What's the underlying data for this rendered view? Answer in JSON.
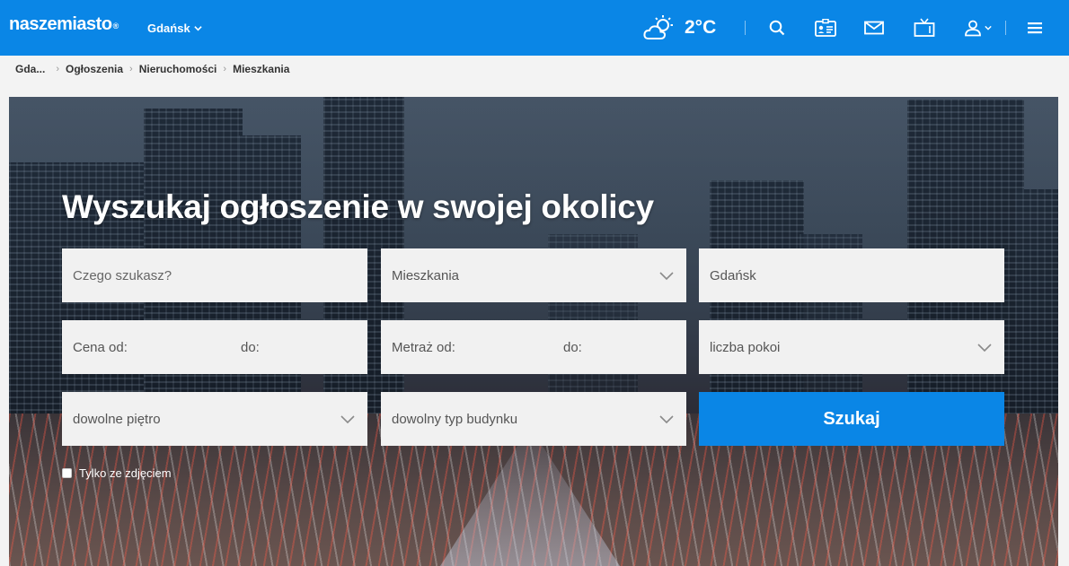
{
  "header": {
    "logo": "naszemiasto",
    "logo_reg": "®",
    "city": "Gdańsk",
    "temperature": "2°C",
    "icons": [
      "weather-icon",
      "search-icon",
      "id-card-icon",
      "mail-icon",
      "tv-icon",
      "user-icon",
      "menu-icon"
    ]
  },
  "breadcrumb": {
    "items": [
      "Gda...",
      "Ogłoszenia",
      "Nieruchomości",
      "Mieszkania"
    ]
  },
  "hero": {
    "title": "Wyszukaj ogłoszenie w swojej okolicy"
  },
  "search": {
    "query_placeholder": "Czego szukasz?",
    "category_value": "Mieszkania",
    "location_value": "Gdańsk",
    "price_from_label": "Cena od:",
    "price_to_label": "do:",
    "area_from_label": "Metraż od:",
    "area_to_label": "do:",
    "rooms_value": "liczba pokoi",
    "floor_value": "dowolne piętro",
    "building_value": "dowolny typ budynku",
    "submit_label": "Szukaj",
    "photo_only_label": "Tylko ze zdjęciem",
    "photo_only_checked": false
  },
  "colors": {
    "brand": "#0a86e6",
    "field_bg": "#f1f1f1"
  }
}
